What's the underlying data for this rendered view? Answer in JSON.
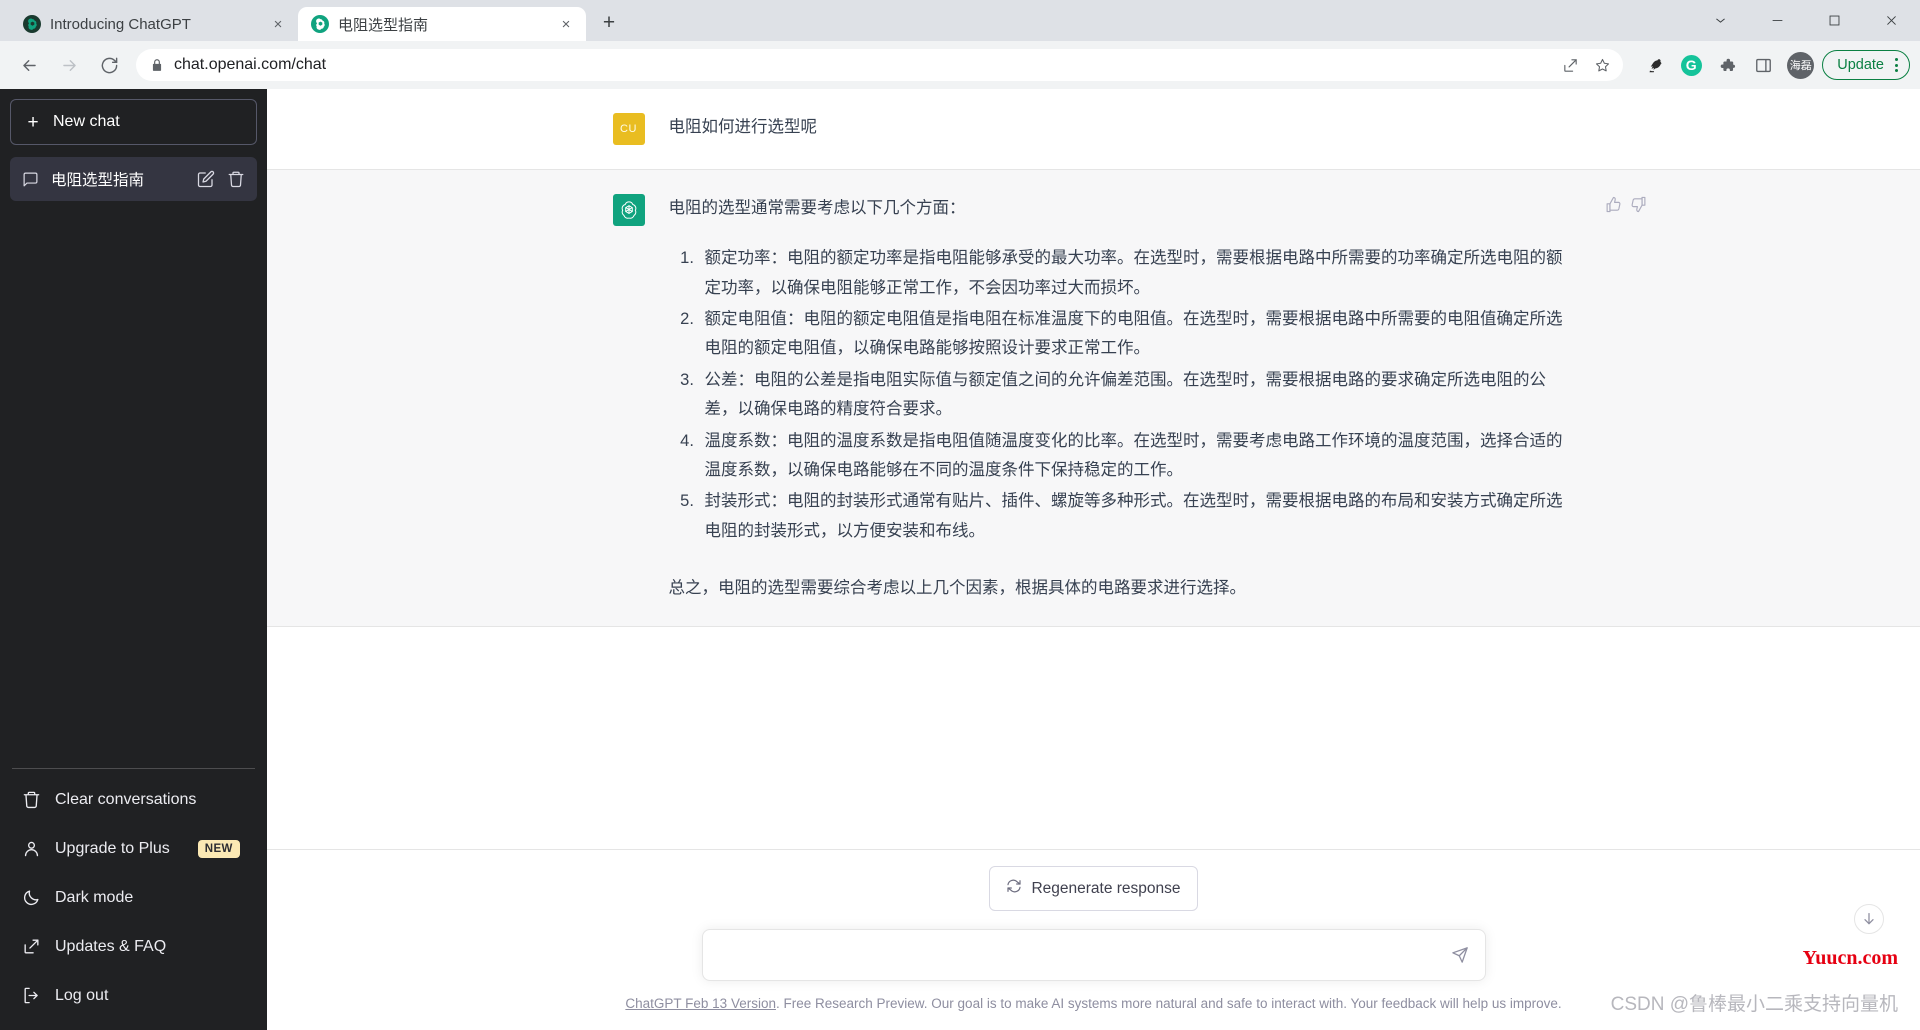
{
  "browser": {
    "tabs": [
      {
        "title": "Introducing ChatGPT",
        "favicon": "chatgpt-icon",
        "active": false,
        "close_label": "×"
      },
      {
        "title": "电阻选型指南",
        "favicon": "chatgpt-icon",
        "active": true,
        "close_label": "×"
      }
    ],
    "new_tab_label": "+",
    "window_controls": {
      "minimize": "–",
      "maximize": "□",
      "close": "✕",
      "collapse": "⌄"
    },
    "toolbar": {
      "back": "back-arrow",
      "forward": "forward-arrow",
      "reload": "reload",
      "url": "chat.openai.com/chat",
      "lock": "lock-icon",
      "share": "share-icon",
      "bookmark": "star-icon",
      "extensions": [
        {
          "name": "bird-extension-icon",
          "label": ""
        },
        {
          "name": "grammarly-icon",
          "label": "G"
        },
        {
          "name": "puzzle-extensions-icon",
          "label": ""
        },
        {
          "name": "side-panel-icon",
          "label": ""
        }
      ],
      "profile_initials": "海磊",
      "update_label": "Update",
      "menu": "kebab-menu"
    }
  },
  "sidebar": {
    "new_chat_label": "New chat",
    "conversations": [
      {
        "title": "电阻选型指南",
        "active": true
      }
    ],
    "menu": [
      {
        "label": "Clear conversations",
        "icon": "trash-icon",
        "badge": ""
      },
      {
        "label": "Upgrade to Plus",
        "icon": "user-icon",
        "badge": "NEW"
      },
      {
        "label": "Dark mode",
        "icon": "moon-icon",
        "badge": ""
      },
      {
        "label": "Updates & FAQ",
        "icon": "external-link-icon",
        "badge": ""
      },
      {
        "label": "Log out",
        "icon": "logout-icon",
        "badge": ""
      }
    ]
  },
  "chat": {
    "user_avatar_initials": "CU",
    "user_message": "电阻如何进行选型呢",
    "assistant_intro": "电阻的选型通常需要考虑以下几个方面：",
    "assistant_list": [
      "额定功率：电阻的额定功率是指电阻能够承受的最大功率。在选型时，需要根据电路中所需要的功率确定所选电阻的额定功率，以确保电阻能够正常工作，不会因功率过大而损坏。",
      "额定电阻值：电阻的额定电阻值是指电阻在标准温度下的电阻值。在选型时，需要根据电路中所需要的电阻值确定所选电阻的额定电阻值，以确保电路能够按照设计要求正常工作。",
      "公差：电阻的公差是指电阻实际值与额定值之间的允许偏差范围。在选型时，需要根据电路的要求确定所选电阻的公差，以确保电路的精度符合要求。",
      "温度系数：电阻的温度系数是指电阻值随温度变化的比率。在选型时，需要考虑电路工作环境的温度范围，选择合适的温度系数，以确保电路能够在不同的温度条件下保持稳定的工作。",
      "封装形式：电阻的封装形式通常有贴片、插件、螺旋等多种形式。在选型时，需要根据电路的布局和安装方式确定所选电阻的封装形式，以方便安装和布线。"
    ],
    "assistant_closing": "总之，电阻的选型需要综合考虑以上几个因素，根据具体的电路要求进行选择。",
    "thumbs_up": "thumbs-up-icon",
    "thumbs_down": "thumbs-down-icon"
  },
  "composer": {
    "regenerate_label": "Regenerate response",
    "input_value": "",
    "input_placeholder": "",
    "send_icon": "send-icon",
    "scroll_to_bottom_icon": "arrow-down-icon"
  },
  "footer": {
    "link_text": "ChatGPT Feb 13 Version",
    "rest_text": ". Free Research Preview. Our goal is to make AI systems more natural and safe to interact with. Your feedback will help us improve."
  },
  "watermarks": {
    "site": "Yuucn.com",
    "csdn": "CSDN @鲁棒最小二乘支持向量机"
  }
}
